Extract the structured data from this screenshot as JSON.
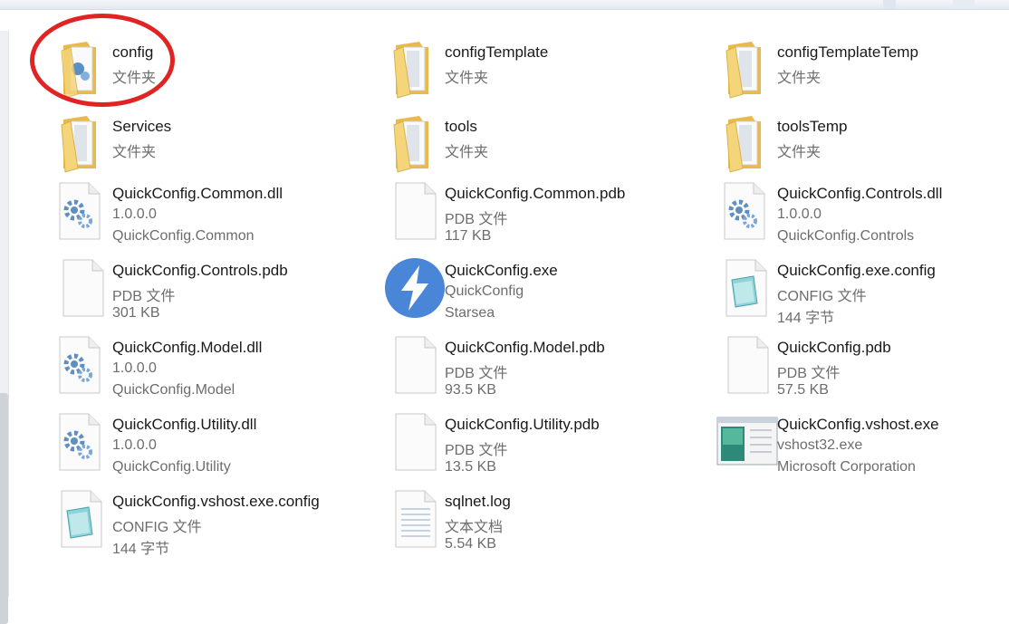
{
  "items": [
    {
      "name": "config",
      "line2": "文件夹",
      "line3": "",
      "icon": "folder-config-icon",
      "col": 0,
      "row": 0
    },
    {
      "name": "configTemplate",
      "line2": "文件夹",
      "line3": "",
      "icon": "folder-icon",
      "col": 1,
      "row": 0
    },
    {
      "name": "configTemplateTemp",
      "line2": "文件夹",
      "line3": "",
      "icon": "folder-icon",
      "col": 2,
      "row": 0
    },
    {
      "name": "Services",
      "line2": "文件夹",
      "line3": "",
      "icon": "folder-icon",
      "col": 0,
      "row": 1
    },
    {
      "name": "tools",
      "line2": "文件夹",
      "line3": "",
      "icon": "folder-icon",
      "col": 1,
      "row": 1
    },
    {
      "name": "toolsTemp",
      "line2": "文件夹",
      "line3": "",
      "icon": "folder-icon",
      "col": 2,
      "row": 1
    },
    {
      "name": "QuickConfig.Common.dll",
      "line2": "1.0.0.0",
      "line3": "QuickConfig.Common",
      "icon": "dll-gear-icon",
      "col": 0,
      "row": 2
    },
    {
      "name": "QuickConfig.Common.pdb",
      "line2": "PDB 文件",
      "line3": "117 KB",
      "icon": "blank-file-icon",
      "col": 1,
      "row": 2
    },
    {
      "name": "QuickConfig.Controls.dll",
      "line2": "1.0.0.0",
      "line3": "QuickConfig.Controls",
      "icon": "dll-gear-icon",
      "col": 2,
      "row": 2
    },
    {
      "name": "QuickConfig.Controls.pdb",
      "line2": "PDB 文件",
      "line3": "301 KB",
      "icon": "blank-file-icon",
      "col": 0,
      "row": 3
    },
    {
      "name": "QuickConfig.exe",
      "line2": "QuickConfig",
      "line3": "Starsea",
      "icon": "lightning-app-icon",
      "col": 1,
      "row": 3
    },
    {
      "name": "QuickConfig.exe.config",
      "line2": "CONFIG 文件",
      "line3": "144 字节",
      "icon": "config-file-icon",
      "col": 2,
      "row": 3
    },
    {
      "name": "QuickConfig.Model.dll",
      "line2": "1.0.0.0",
      "line3": "QuickConfig.Model",
      "icon": "dll-gear-icon",
      "col": 0,
      "row": 4
    },
    {
      "name": "QuickConfig.Model.pdb",
      "line2": "PDB 文件",
      "line3": "93.5 KB",
      "icon": "blank-file-icon",
      "col": 1,
      "row": 4
    },
    {
      "name": "QuickConfig.pdb",
      "line2": "PDB 文件",
      "line3": "57.5 KB",
      "icon": "blank-file-icon",
      "col": 2,
      "row": 4
    },
    {
      "name": "QuickConfig.Utility.dll",
      "line2": "1.0.0.0",
      "line3": "QuickConfig.Utility",
      "icon": "dll-gear-icon",
      "col": 0,
      "row": 5
    },
    {
      "name": "QuickConfig.Utility.pdb",
      "line2": "PDB 文件",
      "line3": "13.5 KB",
      "icon": "blank-file-icon",
      "col": 1,
      "row": 5
    },
    {
      "name": "QuickConfig.vshost.exe",
      "line2": "vshost32.exe",
      "line3": "Microsoft Corporation",
      "icon": "vshost-window-icon",
      "col": 2,
      "row": 5
    },
    {
      "name": "QuickConfig.vshost.exe.config",
      "line2": "CONFIG 文件",
      "line3": "144 字节",
      "icon": "config-file-icon",
      "col": 0,
      "row": 6
    },
    {
      "name": "sqlnet.log",
      "line2": "文本文档",
      "line3": "5.54 KB",
      "icon": "text-file-icon",
      "col": 1,
      "row": 6
    }
  ],
  "colors": {
    "highlight_circle": "#e02424",
    "folder": "#f2cf6b",
    "lightning_bg": "#4a86d8"
  }
}
